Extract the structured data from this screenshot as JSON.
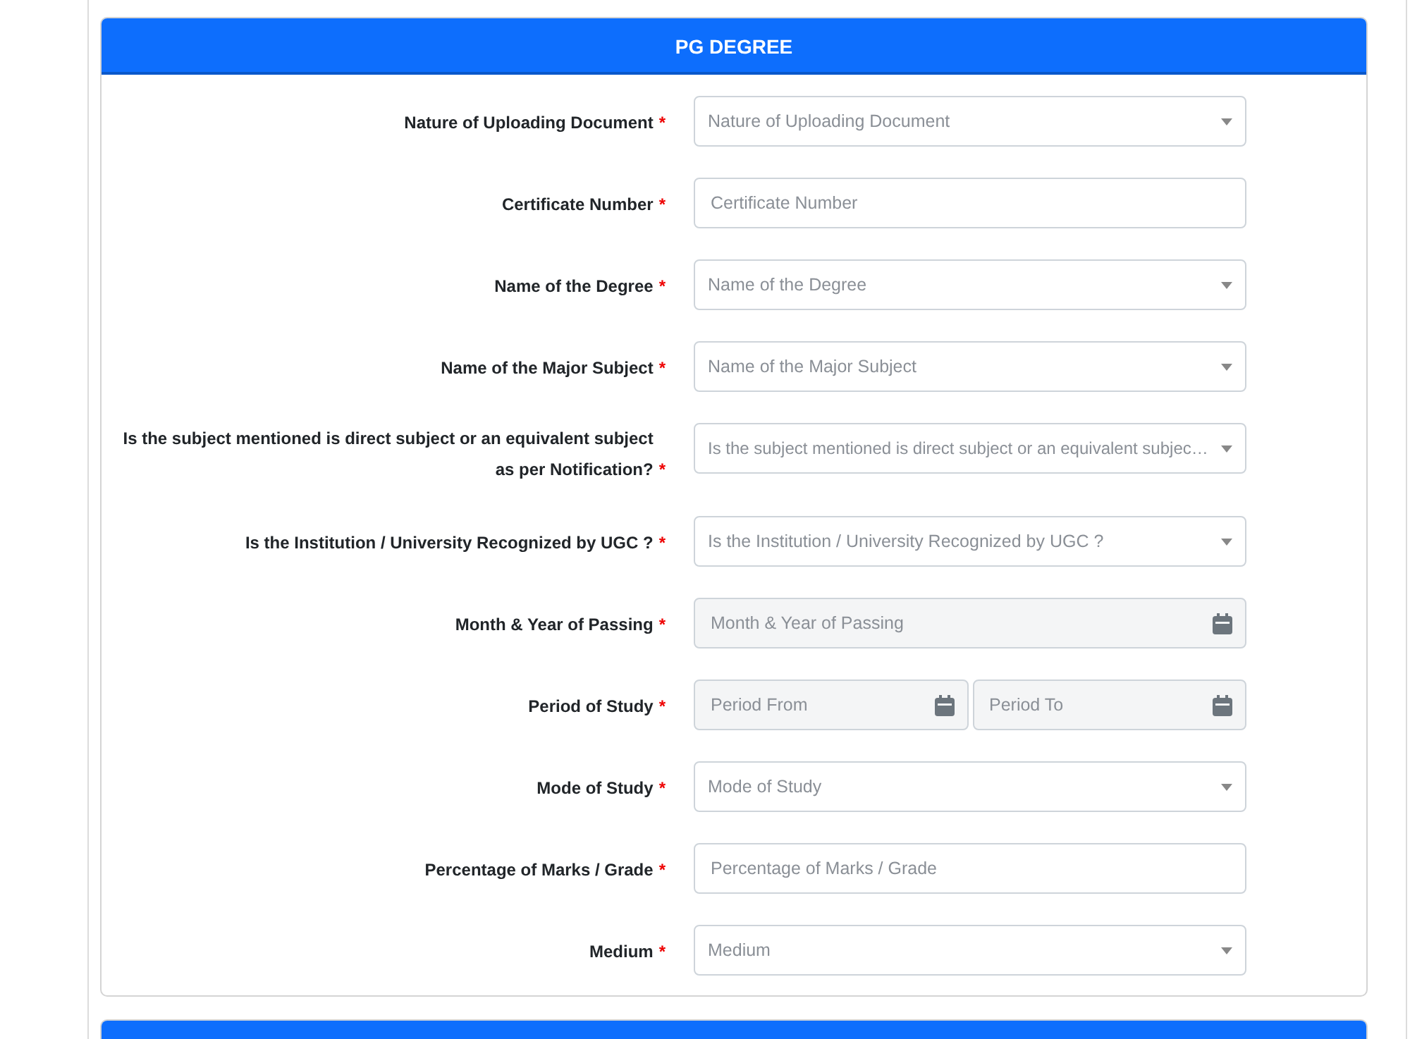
{
  "sections": [
    {
      "kind": "form",
      "title": "PG DEGREE",
      "fields": [
        {
          "label": "Nature of Uploading Document",
          "required_mark": "*",
          "kind": "select",
          "placeholder": "Nature of Uploading Document"
        },
        {
          "label": "Certificate Number",
          "required_mark": "*",
          "kind": "text",
          "placeholder": "Certificate Number"
        },
        {
          "label": "Name of the Degree",
          "required_mark": "*",
          "kind": "select",
          "placeholder": "Name of the Degree"
        },
        {
          "label": "Name of the Major Subject",
          "required_mark": "*",
          "kind": "select",
          "placeholder": "Name of the Major Subject"
        },
        {
          "label": "Is the subject mentioned is direct subject or an equivalent subject as per Notification?",
          "required_mark": "*",
          "kind": "select",
          "placeholder": "Is the subject mentioned is direct subject or an equivalent subjec…"
        },
        {
          "label": "Is the Institution / University Recognized by UGC ?",
          "required_mark": "*",
          "kind": "select",
          "placeholder": "Is the Institution / University Recognized by UGC ?"
        },
        {
          "label": "Month & Year of Passing",
          "required_mark": "*",
          "kind": "date",
          "placeholder": "Month & Year of Passing"
        },
        {
          "label": "Period of Study",
          "required_mark": "*",
          "kind": "daterange",
          "placeholders": [
            "Period From",
            "Period To"
          ]
        },
        {
          "label": "Mode of Study",
          "required_mark": "*",
          "kind": "select",
          "placeholder": "Mode of Study"
        },
        {
          "label": "Percentage of Marks / Grade",
          "required_mark": "*",
          "kind": "text",
          "placeholder": "Percentage of Marks / Grade"
        },
        {
          "label": "Medium",
          "required_mark": "*",
          "kind": "select",
          "placeholder": "Medium"
        }
      ]
    },
    {
      "kind": "header"
    }
  ]
}
